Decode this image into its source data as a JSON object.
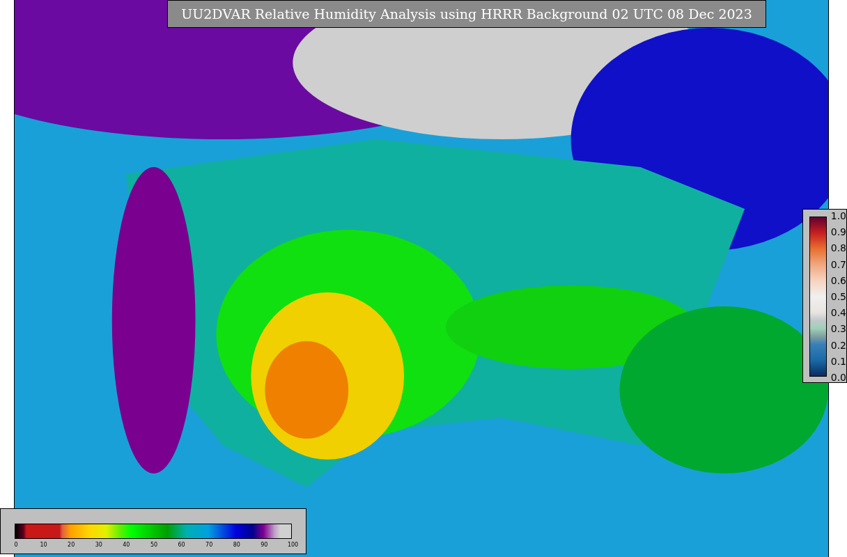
{
  "title": "UU2DVAR Relative Humidity Analysis using HRRR Background 02 UTC 08 Dec 2023",
  "analysis_colorbar": {
    "ticks": [
      "0",
      "10",
      "20",
      "30",
      "40",
      "50",
      "60",
      "70",
      "80",
      "90",
      "100"
    ]
  },
  "observation_colorbar": {
    "ticks": [
      "1.0",
      "0.9",
      "0.8",
      "0.7",
      "0.6",
      "0.5",
      "0.4",
      "0.3",
      "0.2",
      "0.1",
      "0.0"
    ]
  }
}
